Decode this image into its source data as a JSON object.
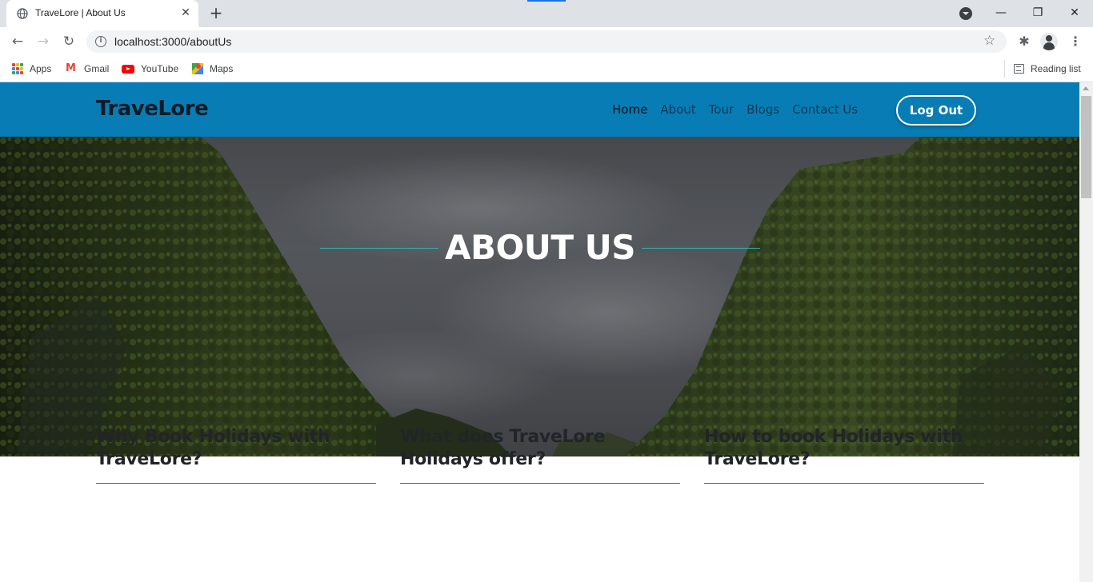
{
  "browser": {
    "tab_title": "TraveLore | About Us",
    "tab_favicon": "globe-icon",
    "url": "localhost:3000/aboutUs",
    "bookmarks": [
      {
        "label": "Apps",
        "icon": "apps-grid-icon"
      },
      {
        "label": "Gmail",
        "icon": "gmail-icon"
      },
      {
        "label": "YouTube",
        "icon": "youtube-icon"
      },
      {
        "label": "Maps",
        "icon": "maps-icon"
      }
    ],
    "reading_list": "Reading list"
  },
  "site": {
    "brand": "TraveLore",
    "nav": [
      "Home",
      "About",
      "Tour",
      "Blogs",
      "Contact Us"
    ],
    "active_nav": "Home",
    "logout_label": "Log Out",
    "hero_title": "ABOUT US",
    "cards": [
      {
        "heading": "Why Book Holidays with TraveLore?"
      },
      {
        "heading": "What does TraveLore Holidays offer?"
      },
      {
        "heading": "How to book Holidays with TraveLore?"
      }
    ]
  },
  "colors": {
    "navbar": "#087db5",
    "hero_accent_line": "#2fb6b0",
    "card_rule": "#b0344e"
  }
}
